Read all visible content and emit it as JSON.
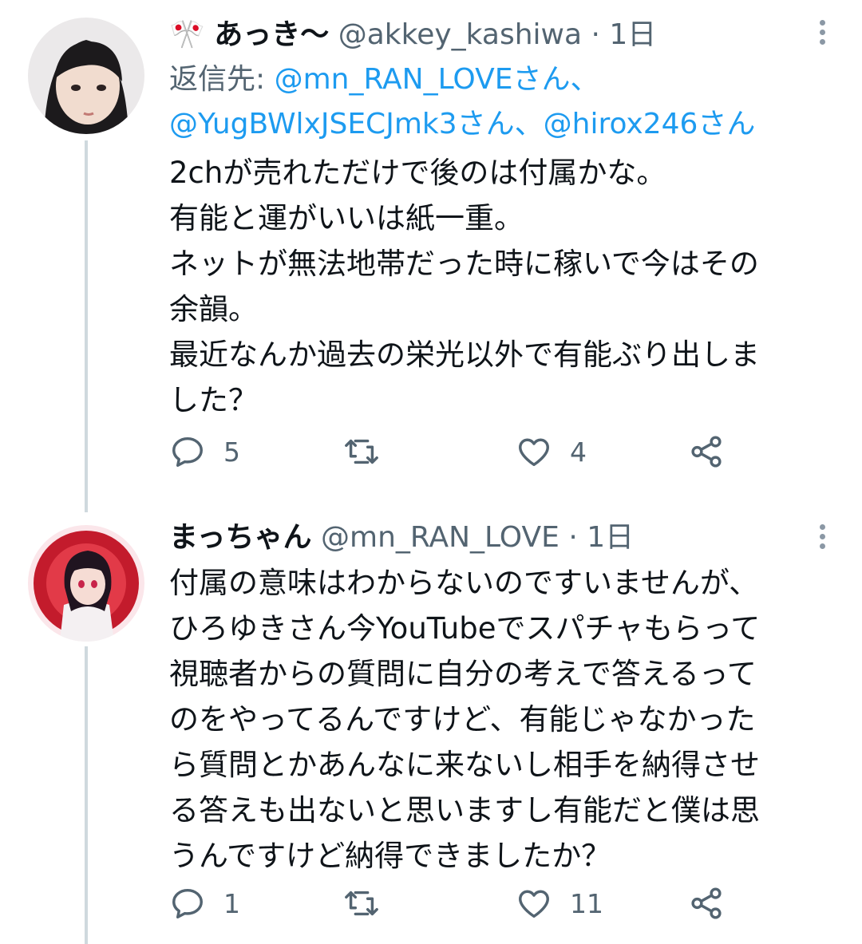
{
  "tweets": [
    {
      "flag": "🎌",
      "display_name": "あっき〜",
      "handle": "@akkey_kashiwa",
      "separator": "·",
      "time": "1日",
      "reply_to": {
        "prefix": "返信先:",
        "mention1": "@mn_RAN_LOVEさん、",
        "mention2": "@YugBWlxJSECJmk3さん、",
        "mention3": "@hirox246さん"
      },
      "text": "2chが売れただけで後のは付属かな。\n有能と運がいいは紙一重。\nネットが無法地帯だった時に稼いで今はその\n余韻。\n最近なんか過去の栄光以外で有能ぶり出しま\nした？",
      "reply_count": "5",
      "retweet_count": "",
      "like_count": "4"
    },
    {
      "display_name": "まっちゃん",
      "handle": "@mn_RAN_LOVE",
      "separator": "·",
      "time": "1日",
      "text": "付属の意味はわからないのですいませんが、\nひろゆきさん今YouTubeでスパチャもらって\n視聴者からの質問に自分の考えで答えるって\nのをやってるんですけど、有能じゃなかった\nら質問とかあんなに来ないし相手を納得させ\nる答えも出ないと思いますし有能だと僕は思\nうんですけど納得できましたか？",
      "reply_count": "1",
      "retweet_count": "",
      "like_count": "11"
    }
  ],
  "colors": {
    "text": "#0f1419",
    "secondary": "#536471",
    "link": "#1d9bf0",
    "thread_line": "#cfd9de"
  },
  "icons": [
    "reply-icon",
    "retweet-icon",
    "like-icon",
    "share-icon",
    "more-icon"
  ]
}
